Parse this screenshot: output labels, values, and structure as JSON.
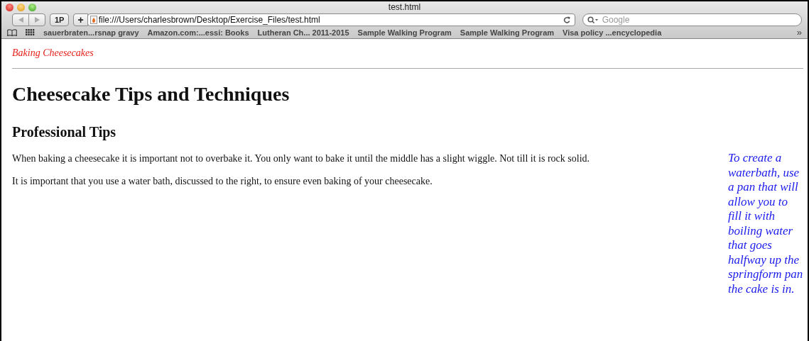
{
  "window": {
    "title": "test.html"
  },
  "toolbar": {
    "reader_button": "1P",
    "add_button": "+",
    "address": "file:///Users/charlesbrown/Desktop/Exercise_Files/test.html",
    "search": {
      "placeholder": "Google"
    }
  },
  "bookmarks": [
    "sauerbraten...rsnap gravy",
    "Amazon.com:...essi: Books",
    "Lutheran Ch... 2011-2015",
    "Sample Walking Program",
    "Sample Walking Program",
    "Visa policy ...encyclopedia"
  ],
  "bookmarks_more": "»",
  "page": {
    "site_link": "Baking Cheesecakes",
    "heading": "Cheesecake Tips and Techniques",
    "subheading": "Professional Tips",
    "paragraphs": [
      "When baking a cheesecake it is important not to overbake it. You only want to bake it until the middle has a slight wiggle. Not till it is rock solid.",
      "It is important that you use a water bath, discussed to the right, to ensure even baking of your cheesecake."
    ],
    "aside": "To create a waterbath, use a pan that will allow you to fill it with boiling water that goes halfway up the springform pan the cake is in."
  }
}
